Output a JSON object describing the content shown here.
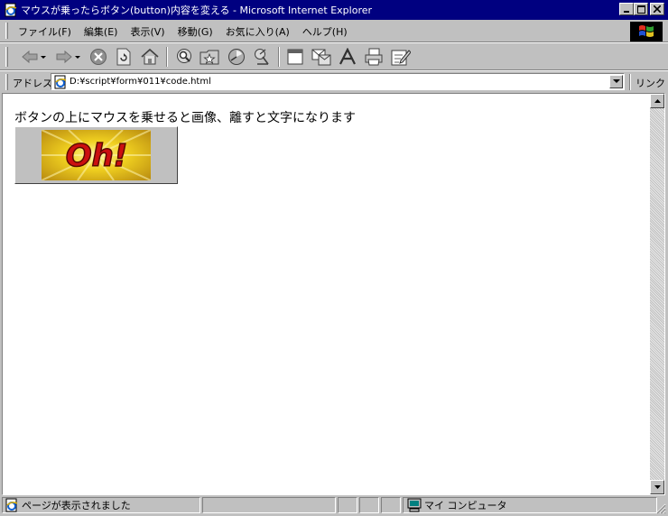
{
  "window": {
    "title": "マウスが乗ったらボタン(button)内容を変える - Microsoft Internet Explorer"
  },
  "menu": {
    "items": [
      "ファイル(F)",
      "編集(E)",
      "表示(V)",
      "移動(G)",
      "お気に入り(A)",
      "ヘルプ(H)"
    ]
  },
  "address": {
    "label": "アドレス",
    "value": "D:¥script¥form¥011¥code.html",
    "links_label": "リンク"
  },
  "page": {
    "instruction": "ボタンの上にマウスを乗せると画像、離すと文字になります",
    "button_image_text": "Oh!"
  },
  "status": {
    "message": "ページが表示されました",
    "zone": "マイ コンピュータ"
  },
  "colors": {
    "titlebar": "#000080",
    "chrome": "#c0c0c0",
    "oh_text": "#cc1010",
    "oh_background": "#e8c21a"
  }
}
